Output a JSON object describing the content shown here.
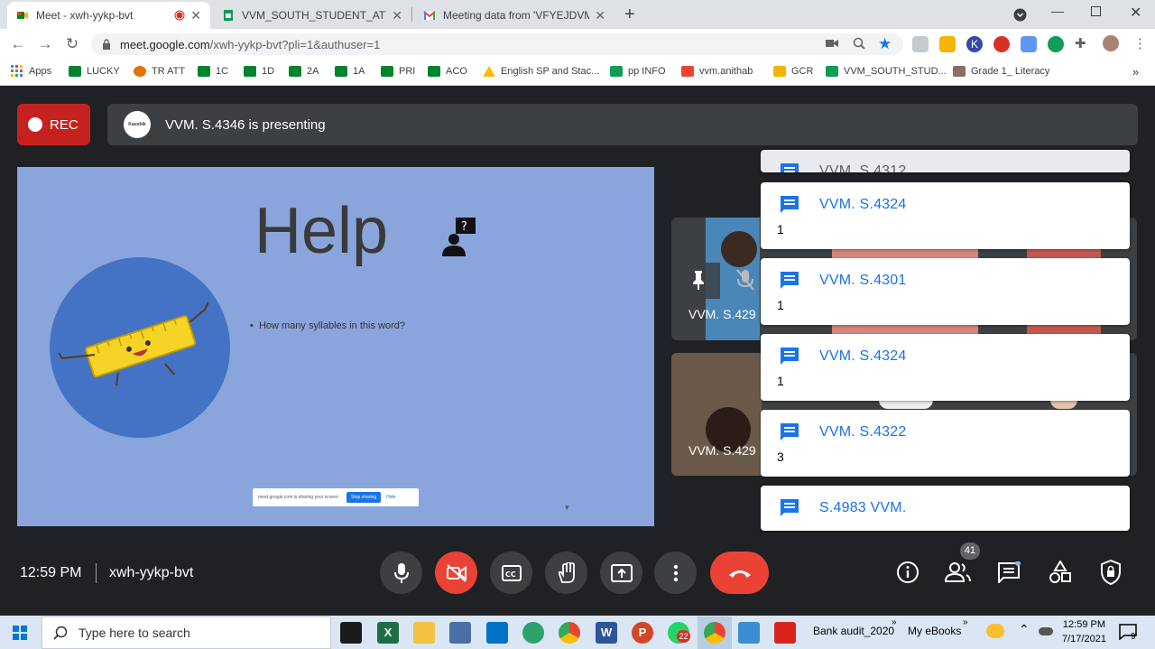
{
  "browser": {
    "tabs": [
      {
        "title": "Meet - xwh-yykp-bvt",
        "active": true
      },
      {
        "title": "VVM_SOUTH_STUDENT_ATTENDA",
        "active": false
      },
      {
        "title": "Meeting data from 'VFYEJDVMZK",
        "active": false
      }
    ],
    "url_host": "meet.google.com",
    "url_path": "/xwh-yykp-bvt?pli=1&authuser=1",
    "bookmarks": [
      "Apps",
      "LUCKY",
      "TR ATT",
      "1C",
      "1D",
      "2A",
      "1A",
      "PRI",
      "ACO",
      "English SP and Stac...",
      "pp INFO",
      "vvm.anithab",
      "GCR",
      "VVM_SOUTH_STUD...",
      "Grade 1_ Literacy"
    ],
    "bookmarks_more": "»"
  },
  "meet": {
    "rec_label": "REC",
    "presenter_avatar_text": "Kaushik",
    "presenting_text": "VVM. S.4346 is presenting",
    "slide": {
      "title": "Help",
      "bullet": "How many  syllables in this word?",
      "share_notice": "meet.google.com is sharing your screen.",
      "stop_sharing": "Stop sharing",
      "hide": "Hide"
    },
    "tiles": [
      {
        "label": "VVM. S.429"
      },
      {
        "label": "VVM. S.429"
      }
    ],
    "chat_cards": [
      {
        "name": "VVM. S.4312",
        "count": ""
      },
      {
        "name": "VVM. S.4324",
        "count": "1"
      },
      {
        "name": "VVM. S.4301",
        "count": "1"
      },
      {
        "name": "VVM. S.4324",
        "count": "1"
      },
      {
        "name": "VVM. S.4322",
        "count": "3"
      },
      {
        "name": "S.4983 VVM.",
        "count": ""
      }
    ],
    "time": "12:59 PM",
    "meeting_code": "xwh-yykp-bvt",
    "participant_count": "41",
    "colors": {
      "end_call": "#ea4335",
      "rec": "#c5221f",
      "accent": "#1a73e8",
      "slide_bg": "#89a5dc"
    }
  },
  "taskbar": {
    "search_placeholder": "Type here to search",
    "whatsapp_badge": "22",
    "bank_audit": "Bank audit_2020",
    "my_ebooks": "My eBooks",
    "clock_time": "12:59 PM",
    "clock_date": "7/17/2021",
    "notif_count": "9"
  }
}
